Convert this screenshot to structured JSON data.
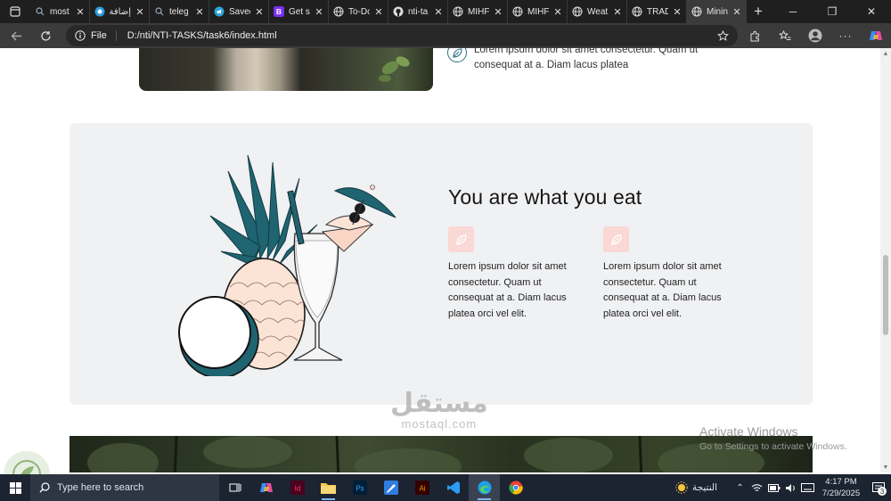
{
  "browser": {
    "tabs": [
      {
        "title": "most",
        "icon": "search-icon",
        "active": false
      },
      {
        "title": "إضافة",
        "icon": "mostaql-icon",
        "active": false
      },
      {
        "title": "teleg",
        "icon": "search-icon",
        "active": false
      },
      {
        "title": "Saved",
        "icon": "telegram-icon",
        "active": false
      },
      {
        "title": "Get st",
        "icon": "bootstrap-icon",
        "active": false
      },
      {
        "title": "To-Do",
        "icon": "globe-icon",
        "active": false
      },
      {
        "title": "nti-ta",
        "icon": "github-icon",
        "active": false
      },
      {
        "title": "MIHF",
        "icon": "globe-icon",
        "active": false
      },
      {
        "title": "MIHF",
        "icon": "globe-icon",
        "active": false
      },
      {
        "title": "Weat",
        "icon": "globe-icon",
        "active": false
      },
      {
        "title": "TRAD",
        "icon": "globe-icon",
        "active": false
      },
      {
        "title": "Minin",
        "icon": "globe-icon",
        "active": true
      }
    ],
    "omnibox": {
      "scheme_label": "File",
      "url": "D:/nti/NTI-TASKS/task6/index.html"
    }
  },
  "page": {
    "top_feature_text": "Lorem ipsum dolor sit amet consectetur. Quam ut consequat at a. Diam lacus platea",
    "section": {
      "heading": "You are what you eat",
      "features": [
        {
          "text": "Lorem ipsum dolor sit amet consectetur. Quam ut consequat at a. Diam lacus platea orci vel elit."
        },
        {
          "text": "Lorem ipsum dolor sit amet consectetur. Quam ut consequat at a. Diam lacus platea orci vel elit."
        }
      ]
    }
  },
  "watermark": {
    "arabic": "مستقل",
    "latin": "mostaql.com"
  },
  "activation": {
    "title": "Activate Windows",
    "subtitle": "Go to Settings to activate Windows."
  },
  "taskbar": {
    "search_placeholder": "Type here to search",
    "weather_label": "النتيجة",
    "time": "4:17 PM",
    "date": "7/29/2025",
    "notification_count": "3"
  },
  "colors": {
    "accent_teal": "#2b6f7e",
    "badge_pink": "#f9d8d6",
    "section_bg": "#f0f1f3"
  }
}
